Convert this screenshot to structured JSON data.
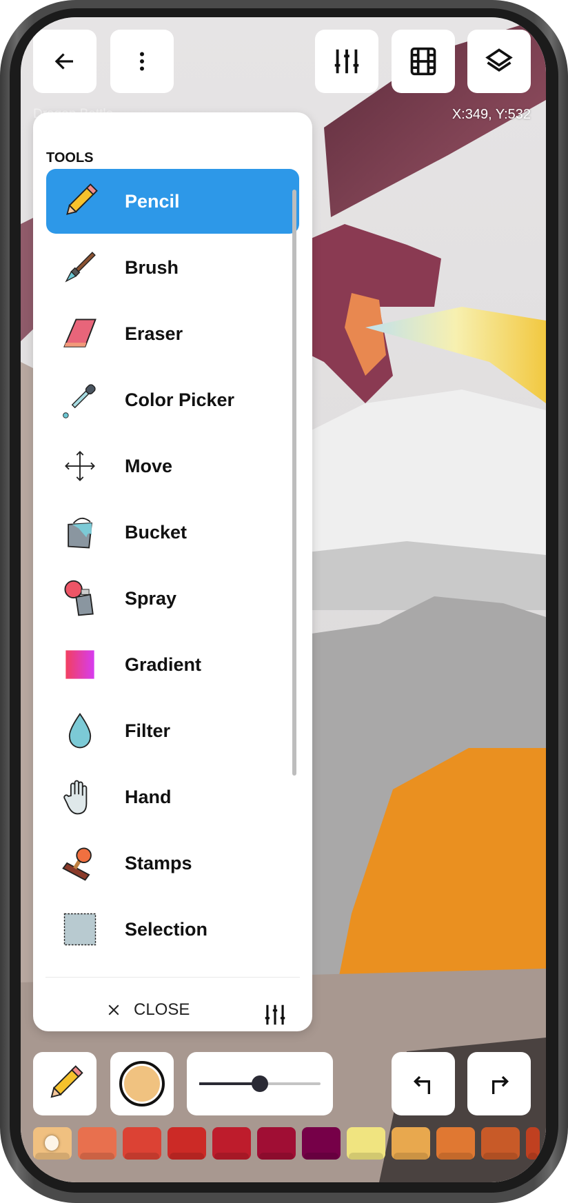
{
  "header": {
    "title": "Dragon Battle",
    "coords": "X:349, Y:532",
    "buttons": [
      {
        "icon": "back-arrow-icon"
      },
      {
        "icon": "more-vertical-icon"
      },
      {
        "icon": "sliders-icon"
      },
      {
        "icon": "film-icon"
      },
      {
        "icon": "layers-icon"
      }
    ]
  },
  "tools_panel": {
    "title": "TOOLS",
    "selected": "Pencil",
    "items": [
      {
        "label": "Pencil",
        "icon": "pencil-icon"
      },
      {
        "label": "Brush",
        "icon": "brush-icon"
      },
      {
        "label": "Eraser",
        "icon": "eraser-icon"
      },
      {
        "label": "Color Picker",
        "icon": "eyedropper-icon"
      },
      {
        "label": "Move",
        "icon": "move-icon"
      },
      {
        "label": "Bucket",
        "icon": "bucket-icon"
      },
      {
        "label": "Spray",
        "icon": "spray-icon"
      },
      {
        "label": "Gradient",
        "icon": "gradient-icon"
      },
      {
        "label": "Filter",
        "icon": "droplet-icon"
      },
      {
        "label": "Hand",
        "icon": "hand-icon"
      },
      {
        "label": "Stamps",
        "icon": "stamp-icon"
      },
      {
        "label": "Selection",
        "icon": "selection-icon"
      }
    ],
    "close_label": "CLOSE"
  },
  "bottom_bar": {
    "current_tool": "pencil-icon",
    "current_color": "#f0c280",
    "brush_size_percent": 50
  },
  "palette": {
    "selected_index": 0,
    "colors": [
      "#f0c080",
      "#e8704e",
      "#dc4234",
      "#cc2a26",
      "#be1c2c",
      "#a00e34",
      "#760048",
      "#f0e480",
      "#e8a84e",
      "#e07832",
      "#c85a28",
      "#c04020"
    ]
  },
  "colors": {
    "accent": "#2d98e8"
  }
}
